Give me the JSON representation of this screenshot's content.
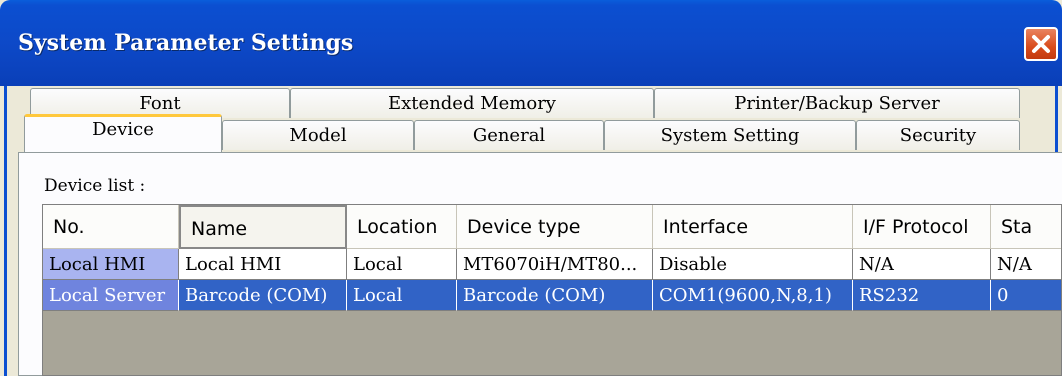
{
  "window": {
    "title": "System Parameter Settings",
    "close_icon": "close-icon"
  },
  "tabs_row_back": [
    "Font",
    "Extended Memory",
    "Printer/Backup Server"
  ],
  "tabs_row_front": [
    "Device",
    "Model",
    "General",
    "System Setting",
    "Security"
  ],
  "active_tab": "Device",
  "device_list_label": "Device list :",
  "table": {
    "columns": [
      "No.",
      "Name",
      "Location",
      "Device type",
      "Interface",
      "I/F Protocol",
      "Sta"
    ],
    "rows": [
      [
        "Local HMI",
        "Local HMI",
        "Local",
        "MT6070iH/MT80...",
        "Disable",
        "N/A",
        "N/A"
      ],
      [
        "Local Server",
        "Barcode (COM)",
        "Local",
        "Barcode (COM)",
        "COM1(9600,N,8,1)",
        "RS232",
        "0"
      ]
    ],
    "selected_row": 1
  },
  "colors": {
    "titlebar": "#0b4fd1",
    "selected_row": "#3163c6",
    "active_tab_accent": "#ffc83c"
  }
}
